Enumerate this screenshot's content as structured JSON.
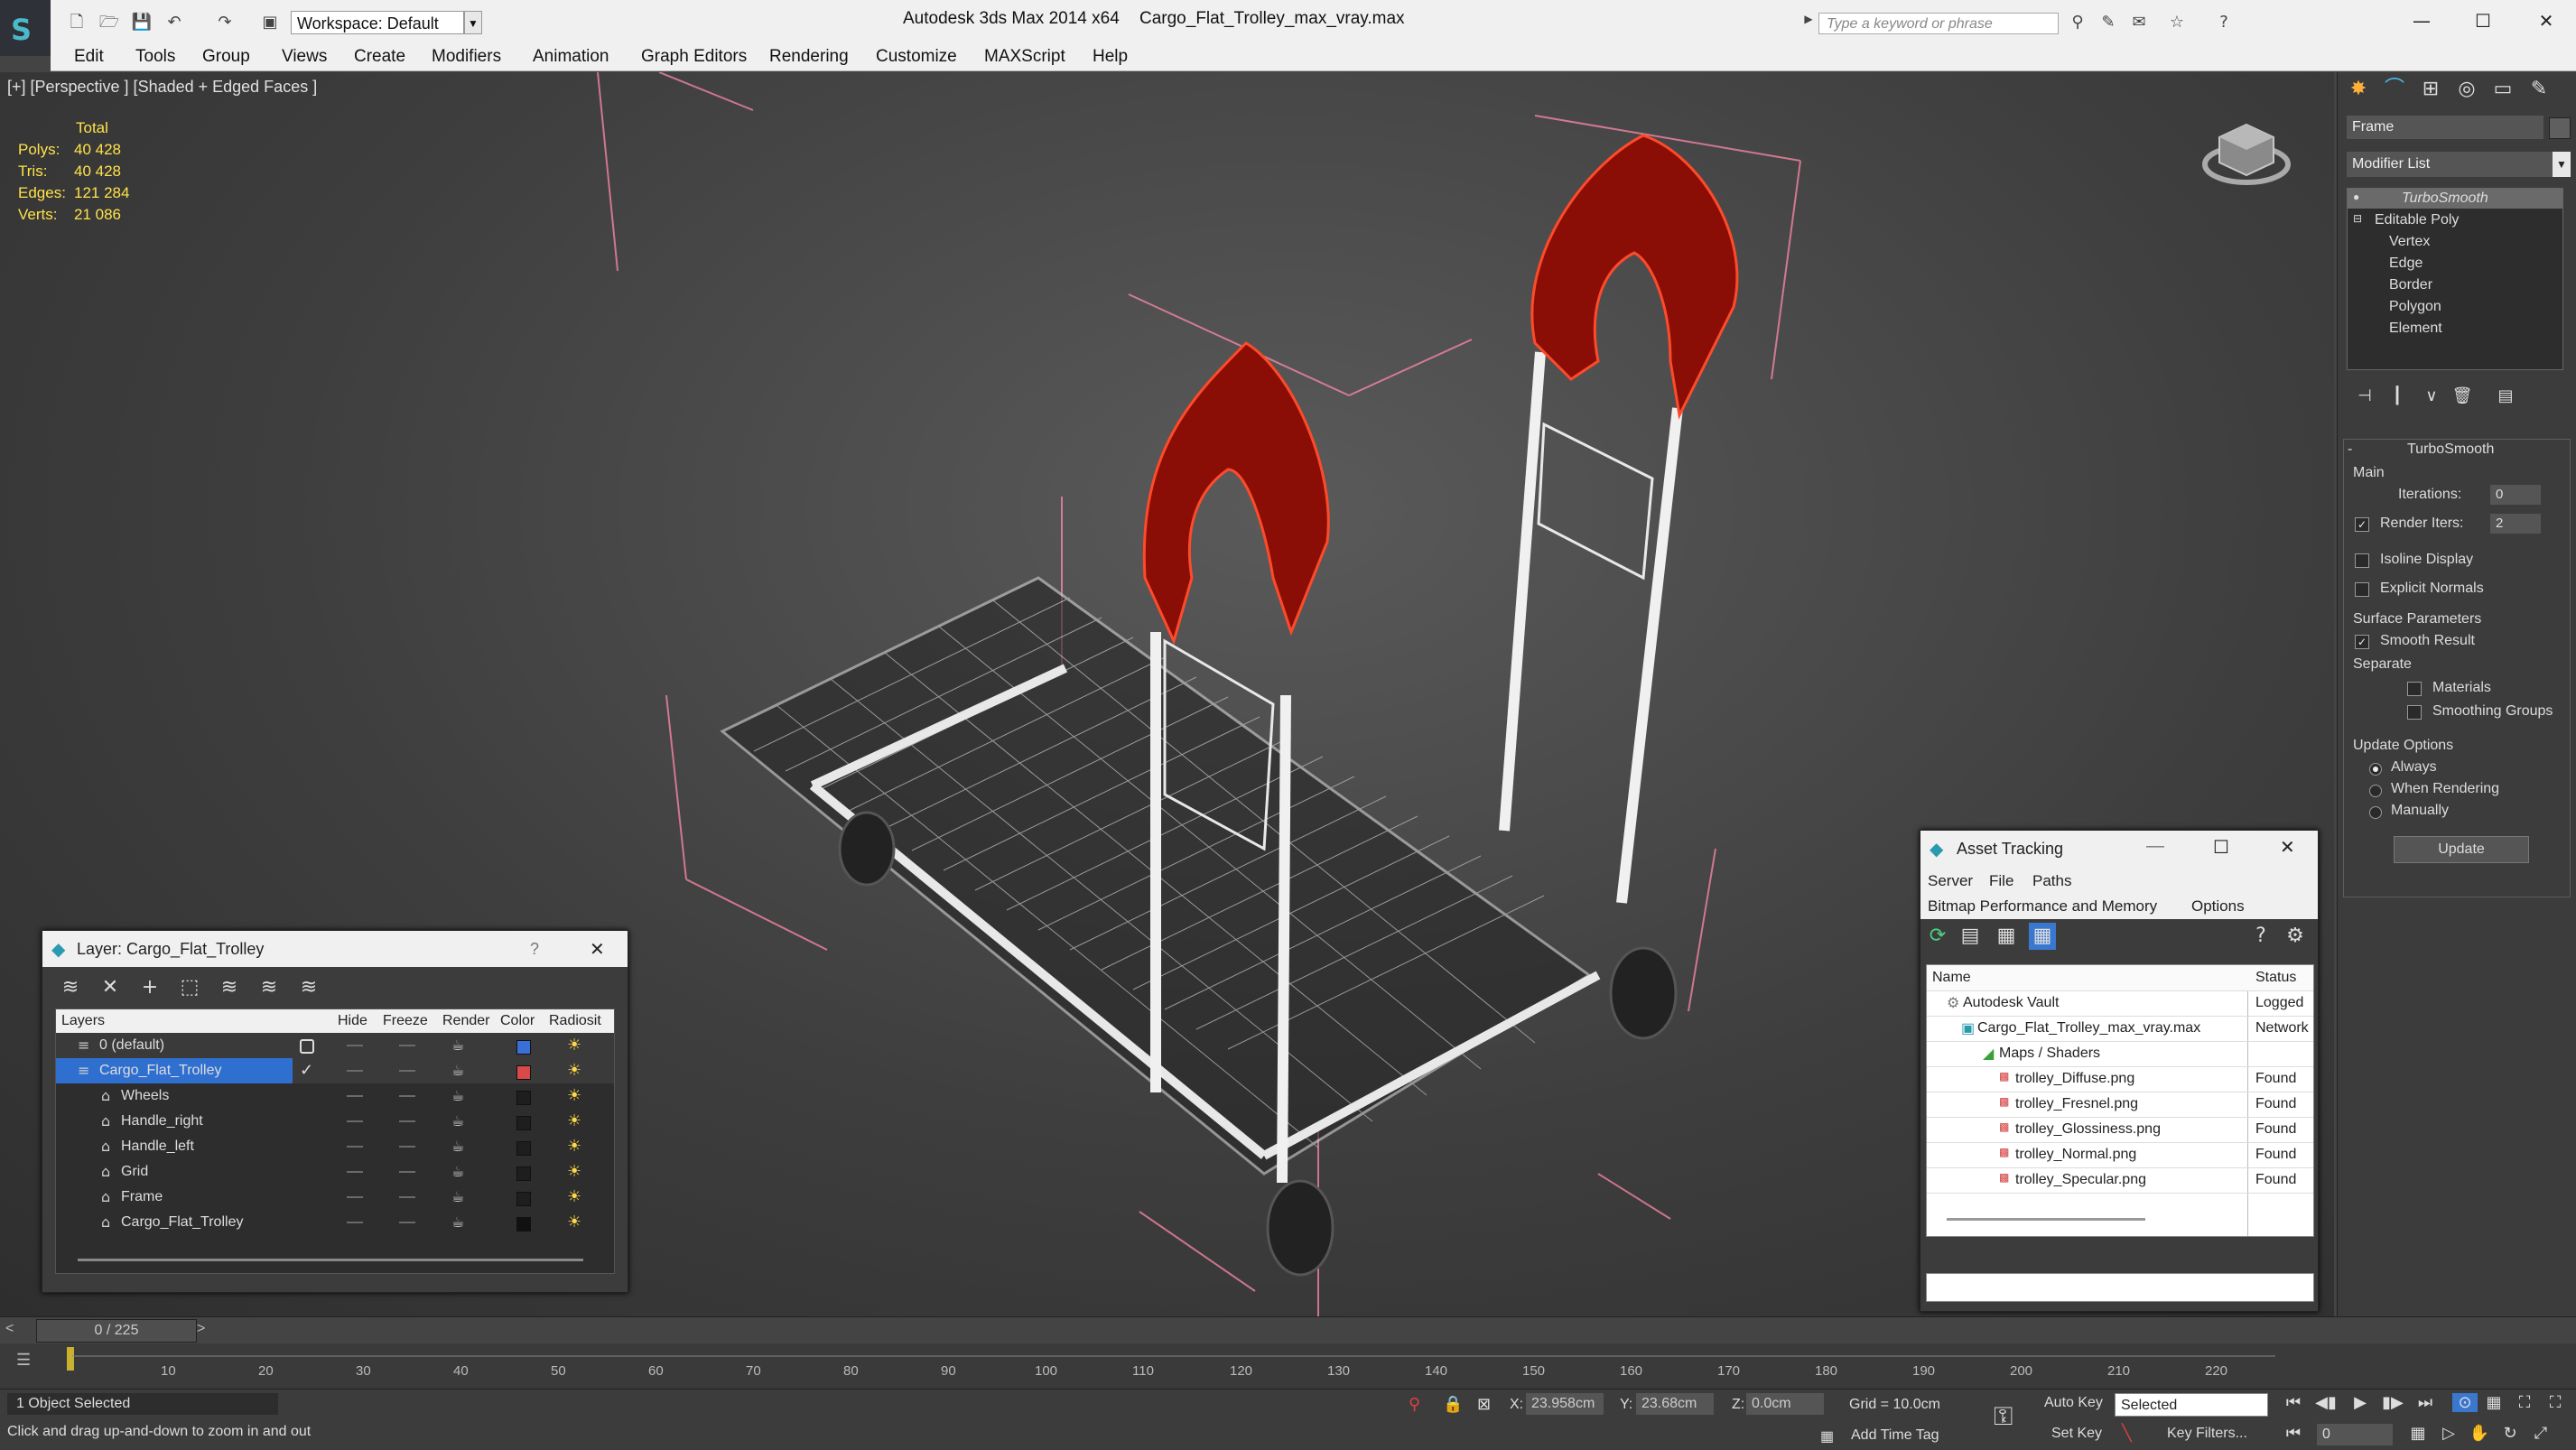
{
  "title_bar": {
    "workspace_label": "Workspace: Default",
    "app_title": "Autodesk 3ds Max  2014 x64",
    "file_title": "Cargo_Flat_Trolley_max_vray.max",
    "search_placeholder": "Type a keyword or phrase"
  },
  "menu": [
    "Edit",
    "Tools",
    "Group",
    "Views",
    "Create",
    "Modifiers",
    "Animation",
    "Graph Editors",
    "Rendering",
    "Customize",
    "MAXScript",
    "Help"
  ],
  "viewport": {
    "label": "[+] [Perspective ] [Shaded + Edged Faces ]",
    "stats_header": "Total",
    "stats": [
      {
        "key": "Polys:",
        "value": "40 428"
      },
      {
        "key": "Tris:",
        "value": "40 428"
      },
      {
        "key": "Edges:",
        "value": "121 284"
      },
      {
        "key": "Verts:",
        "value": "21 086"
      }
    ]
  },
  "command_panel": {
    "object_name": "Frame",
    "modifier_list": "Modifier List",
    "stack": [
      "TurboSmooth",
      "Editable Poly",
      "Vertex",
      "Edge",
      "Border",
      "Polygon",
      "Element"
    ],
    "rollout_title": "TurboSmooth",
    "main_label": "Main",
    "iterations_label": "Iterations:",
    "iterations_value": "0",
    "render_iters_label": "Render Iters:",
    "render_iters_value": "2",
    "isoline_label": "Isoline Display",
    "explicit_normals_label": "Explicit Normals",
    "surface_params_label": "Surface Parameters",
    "smooth_result_label": "Smooth Result",
    "separate_label": "Separate",
    "materials_label": "Materials",
    "smoothing_groups_label": "Smoothing Groups",
    "update_options_label": "Update Options",
    "always_label": "Always",
    "when_rendering_label": "When Rendering",
    "manually_label": "Manually",
    "update_button": "Update"
  },
  "layer_dialog": {
    "title": "Layer: Cargo_Flat_Trolley",
    "help": "?",
    "columns": [
      "Layers",
      "Hide",
      "Freeze",
      "Render",
      "Color",
      "Radiosit"
    ],
    "rows": [
      {
        "name": "0 (default)",
        "color": "#3a6fd8"
      },
      {
        "name": "Cargo_Flat_Trolley",
        "color": "#d84a4a"
      },
      {
        "name": "Wheels",
        "color": "#1e1e1e"
      },
      {
        "name": "Handle_right",
        "color": "#1e1e1e"
      },
      {
        "name": "Handle_left",
        "color": "#1e1e1e"
      },
      {
        "name": "Grid",
        "color": "#1e1e1e"
      },
      {
        "name": "Frame",
        "color": "#1e1e1e"
      },
      {
        "name": "Cargo_Flat_Trolley",
        "color": "#111111"
      }
    ]
  },
  "asset_tracking": {
    "title": "Asset Tracking",
    "menu_row1": [
      "Server",
      "File",
      "Paths"
    ],
    "menu_row2": [
      "Bitmap Performance and Memory",
      "Options"
    ],
    "columns": [
      "Name",
      "Status"
    ],
    "rows": [
      {
        "name": "Autodesk Vault",
        "status": "Logged"
      },
      {
        "name": "Cargo_Flat_Trolley_max_vray.max",
        "status": "Network"
      },
      {
        "name": "Maps / Shaders",
        "status": ""
      },
      {
        "name": "trolley_Diffuse.png",
        "status": "Found"
      },
      {
        "name": "trolley_Fresnel.png",
        "status": "Found"
      },
      {
        "name": "trolley_Glossiness.png",
        "status": "Found"
      },
      {
        "name": "trolley_Normal.png",
        "status": "Found"
      },
      {
        "name": "trolley_Specular.png",
        "status": "Found"
      }
    ]
  },
  "timeline": {
    "frame_display": "0 / 225",
    "ticks": [
      "10",
      "20",
      "30",
      "40",
      "50",
      "60",
      "70",
      "80",
      "90",
      "100",
      "110",
      "120",
      "130",
      "140",
      "150",
      "160",
      "170",
      "180",
      "190",
      "200",
      "210",
      "220"
    ]
  },
  "status_bar": {
    "selection": "1 Object Selected",
    "prompt": "Click and drag up-and-down to zoom in and out",
    "x_label": "X:",
    "x_value": "23.958cm",
    "y_label": "Y:",
    "y_value": "23.68cm",
    "z_label": "Z:",
    "z_value": "0.0cm",
    "grid": "Grid = 10.0cm",
    "auto_key": "Auto Key",
    "selected_dropdown": "Selected",
    "set_key": "Set Key",
    "key_filters": "Key Filters...",
    "add_time_tag": "Add Time Tag",
    "frame_value": "0"
  }
}
